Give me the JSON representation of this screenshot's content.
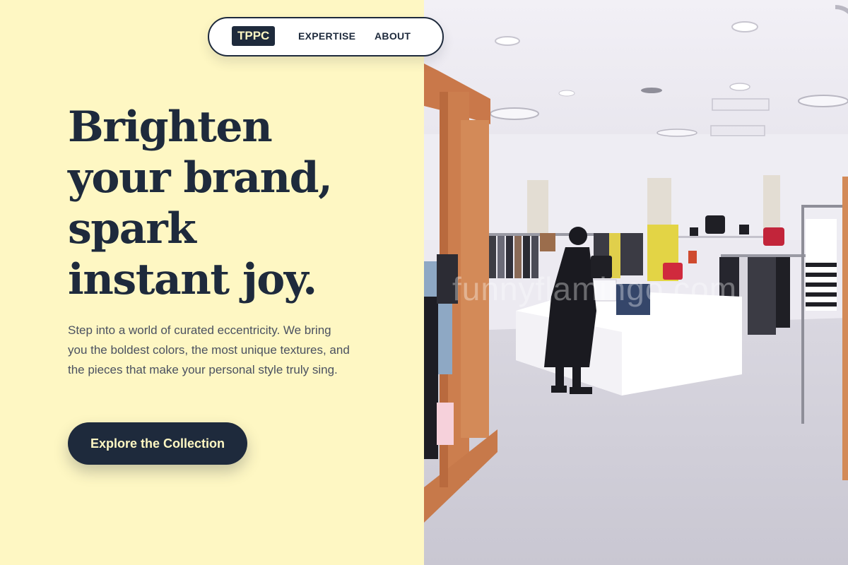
{
  "nav": {
    "logo": "TPPC",
    "links": [
      "EXPERTISE",
      "ABOUT"
    ]
  },
  "hero": {
    "headline_lines": [
      "Brighten",
      "your brand,",
      "spark",
      "instant joy."
    ],
    "subtext": "Step into a world of curated eccentricity. We bring you the boldest colors, the most unique textures, and the pieces that make your personal style truly sing.",
    "cta_label": "Explore the Collection"
  },
  "image": {
    "watermark": "funnyflamingo.com",
    "subject": "retail-clothing-store-photo"
  },
  "colors": {
    "background": "#fef7c3",
    "primary": "#1e2a3c",
    "body_text": "#4b5160"
  }
}
